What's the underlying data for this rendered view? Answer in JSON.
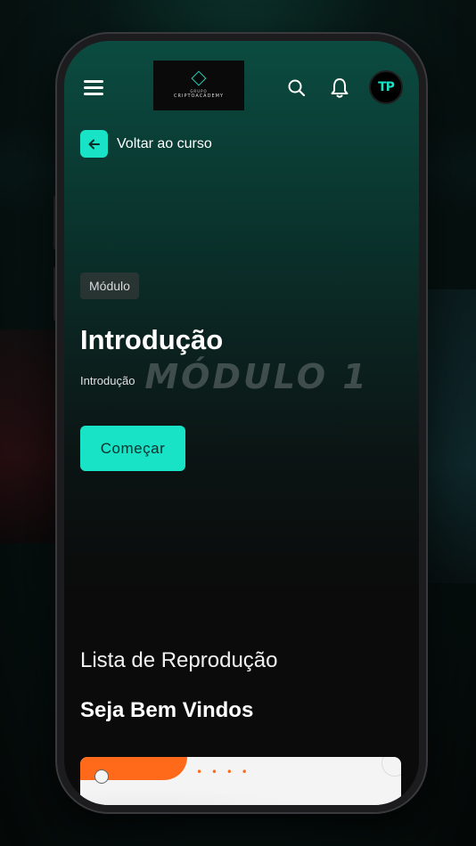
{
  "header": {
    "logo_small": "GRUPO",
    "logo_text": "CRIPTOACADEMY",
    "avatar_text": "TP"
  },
  "back_link": {
    "label": "Voltar ao curso"
  },
  "module": {
    "badge": "Módulo",
    "title": "Introdução",
    "subtitle": "Introdução",
    "watermark": "MÓDULO 1",
    "start_button": "Começar"
  },
  "playlist": {
    "section_title": "Lista de Reprodução",
    "group_title": "Seja Bem Vindos"
  },
  "colors": {
    "accent": "#19e3c7",
    "card_accent": "#ff6a1a"
  },
  "icons": {
    "menu": "menu-icon",
    "search": "search-icon",
    "notifications": "bell-icon",
    "back": "arrow-left-icon"
  }
}
